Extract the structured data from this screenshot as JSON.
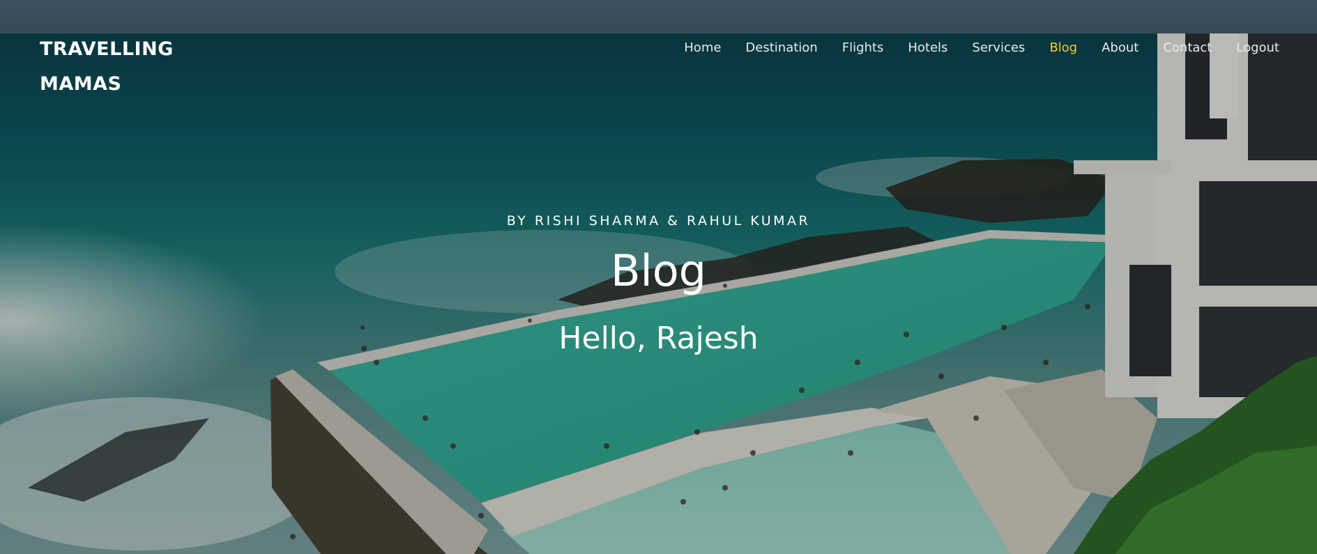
{
  "brand": {
    "line1": "TRAVELLING",
    "line2": "MAMAS"
  },
  "nav": [
    {
      "label": "Home",
      "active": false
    },
    {
      "label": "Destination",
      "active": false
    },
    {
      "label": "Flights",
      "active": false
    },
    {
      "label": "Hotels",
      "active": false
    },
    {
      "label": "Services",
      "active": false
    },
    {
      "label": "Blog",
      "active": true
    },
    {
      "label": "About",
      "active": false
    },
    {
      "label": "Contact",
      "active": false
    },
    {
      "label": "Logout",
      "active": false
    }
  ],
  "hero": {
    "byline": "BY RISHI SHARMA & RAHUL KUMAR",
    "title": "Blog",
    "greeting": "Hello, Rajesh"
  },
  "colors": {
    "active_nav": "#f2d033",
    "text": "#ffffff"
  }
}
